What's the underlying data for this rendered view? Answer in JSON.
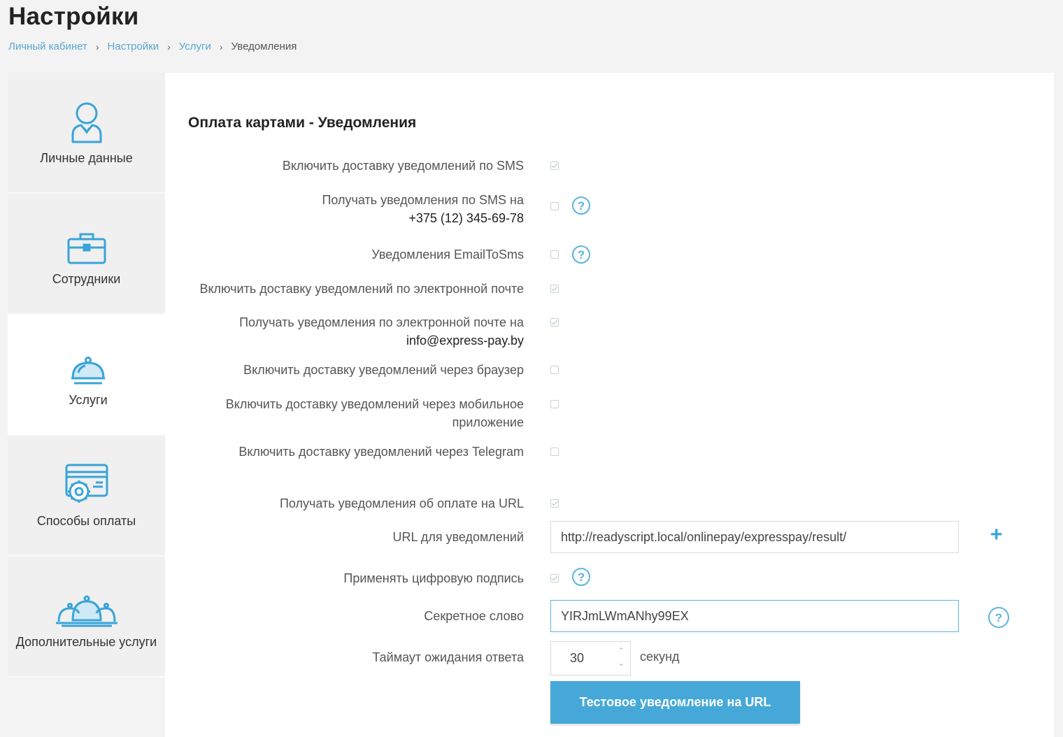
{
  "page": {
    "title": "Настройки",
    "breadcrumb": [
      "Личный кабинет",
      "Настройки",
      "Услуги"
    ],
    "breadcrumb_current": "Уведомления",
    "breadcrumb_separator": "›"
  },
  "sidebar": {
    "items": [
      {
        "label": "Личные данные",
        "icon": "user-icon"
      },
      {
        "label": "Сотрудники",
        "icon": "briefcase-icon"
      },
      {
        "label": "Услуги",
        "icon": "cloche-icon",
        "active": true
      },
      {
        "label": "Способы оплаты",
        "icon": "payment-settings-icon"
      },
      {
        "label": "Дополнительные услуги",
        "icon": "multiple-cloche-icon"
      }
    ]
  },
  "main": {
    "section_title": "Оплата картами - Уведомления",
    "options": {
      "sms_delivery": {
        "label": "Включить доставку уведомлений по SMS",
        "checked": true
      },
      "sms_receive": {
        "label": "Получать уведомления по SMS на",
        "value": "+375 (12) 345-69-78",
        "checked": false
      },
      "email_to_sms": {
        "label": "Уведомления EmailToSms",
        "checked": false
      },
      "email_delivery": {
        "label": "Включить доставку уведомлений по электронной почте",
        "checked": true
      },
      "email_receive": {
        "label": "Получать уведомления по электронной почте на",
        "value": "info@express-pay.by",
        "checked": true
      },
      "browser_delivery": {
        "label": "Включить доставку уведомлений через браузер",
        "checked": false
      },
      "mobile_delivery": {
        "label_line1": "Включить доставку уведомлений через мобильное",
        "label_line2": "приложение",
        "checked": false
      },
      "telegram_delivery": {
        "label": "Включить доставку уведомлений через Telegram",
        "checked": false
      },
      "url_receive": {
        "label": "Получать уведомления об оплате на URL",
        "checked": true
      },
      "url_field": {
        "label": "URL для уведомлений",
        "value": "http://readyscript.local/onlinepay/expresspay/result/"
      },
      "digital_signature": {
        "label": "Применять цифровую подпись",
        "checked": true
      },
      "secret_word": {
        "label": "Секретное слово",
        "value": "YIRJmLWmANhy99EX"
      },
      "timeout": {
        "label": "Таймаут ожидания ответа",
        "value": "30",
        "suffix": "секунд"
      }
    },
    "help_symbol": "?",
    "add_symbol": "+",
    "test_button": "Тестовое уведомление на URL"
  },
  "colors": {
    "accent": "#45a8d8",
    "link": "#5aa7d3",
    "icon": "#3aa4d8"
  }
}
